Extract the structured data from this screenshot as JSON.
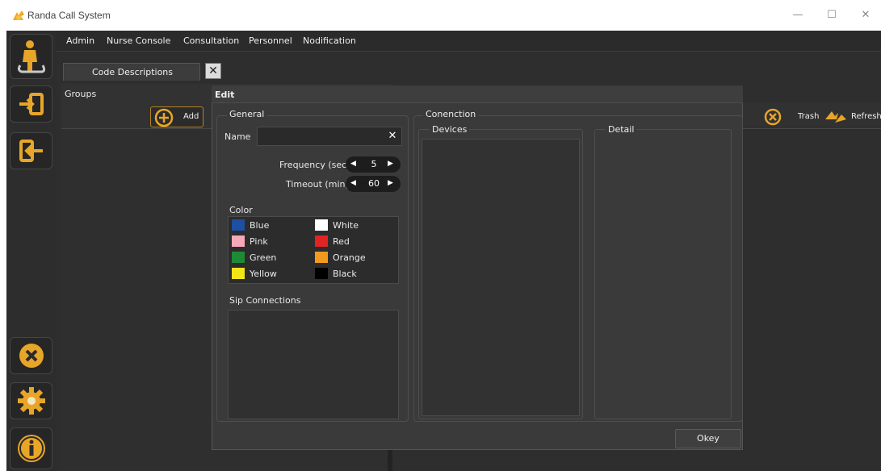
{
  "window": {
    "title": "Randa Call System",
    "controls": {
      "minimize": "—",
      "maximize": "☐",
      "close": "✕"
    }
  },
  "menu": [
    "Admin",
    "Nurse Console",
    "Consultation",
    "Personnel",
    "Nodification"
  ],
  "tab": {
    "label": "Code Descriptions",
    "close_icon": "close-icon"
  },
  "groups": {
    "label": "Groups",
    "add_label": "Add"
  },
  "toolbar": {
    "trash_label": "Trash",
    "refresh_label": "Refresh"
  },
  "dialog": {
    "title": "Edit",
    "general": {
      "legend": "General",
      "name_label": "Name",
      "name_value": "",
      "frequency_label": "Frequency (sec)",
      "frequency_value": "5",
      "timeout_label": "Timeout (min)",
      "timeout_value": "60",
      "color_label": "Color",
      "colors": [
        {
          "name": "Blue",
          "hex": "#1f4fa3"
        },
        {
          "name": "White",
          "hex": "#ffffff"
        },
        {
          "name": "Pink",
          "hex": "#f4a9b8"
        },
        {
          "name": "Red",
          "hex": "#e02424"
        },
        {
          "name": "Green",
          "hex": "#1e8a35"
        },
        {
          "name": "Orange",
          "hex": "#f39a1e"
        },
        {
          "name": "Yellow",
          "hex": "#f2e51a"
        },
        {
          "name": "Black",
          "hex": "#000000"
        }
      ],
      "sip_label": "Sip Connections"
    },
    "connection": {
      "legend": "Conenction",
      "devices_label": "Devices",
      "detail_label": "Detail"
    },
    "okey_label": "Okey"
  },
  "colors": {
    "accent": "#e8a628",
    "panel": "#2e2e2e",
    "dialog": "#3a3a3a"
  }
}
